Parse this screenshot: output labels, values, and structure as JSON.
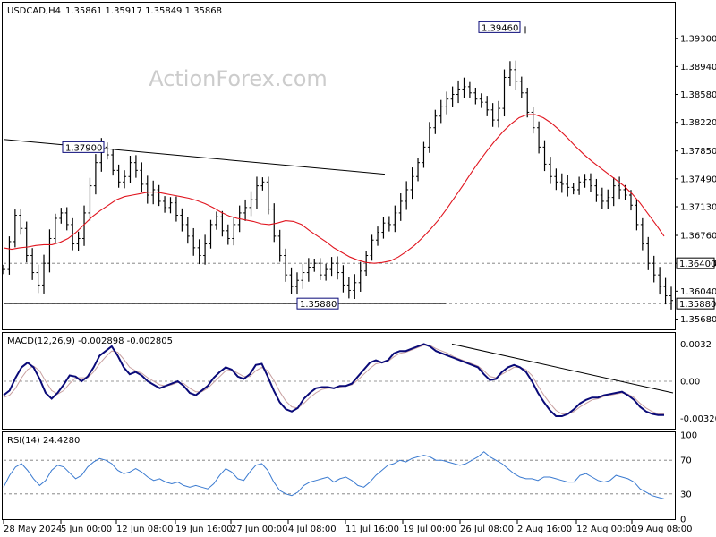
{
  "header": {
    "symbol_timeframe": "USDCAD,H4",
    "ohlc": "1.35861 1.35917 1.35849 1.35868"
  },
  "watermark": "ActionForex.com",
  "colors": {
    "price_bars": "#000000",
    "ema": "#e0141e",
    "macd_main": "#0a0a78",
    "macd_signal": "#c8a0a0",
    "rsi": "#3a7ad0",
    "trendline": "#000000",
    "label_border": "#0a0a78",
    "background": "#ffffff"
  },
  "chart_data": [
    {
      "type": "ohlc",
      "pane": "price",
      "symbol": "USDCAD",
      "timeframe": "H4",
      "y_ticks": [
        "1.39300",
        "1.38940",
        "1.38580",
        "1.38220",
        "1.37850",
        "1.37490",
        "1.37130",
        "1.36760",
        "1.36400",
        "1.36040",
        "1.35680"
      ],
      "ylim": [
        1.3557,
        1.3973
      ],
      "x_ticks": [
        "28 May 2024",
        "5 Jun 00:00",
        "12 Jun 08:00",
        "19 Jun 16:00",
        "27 Jun 00:00",
        "4 Jul 08:00",
        "11 Jul 16:00",
        "19 Jul 00:00",
        "26 Jul 08:00",
        "2 Aug 16:00",
        "12 Aug 00:00",
        "19 Aug 08:00"
      ],
      "key_levels": [
        {
          "label": "1.39460",
          "value": 1.3946
        },
        {
          "label": "1.37900",
          "value": 1.379
        },
        {
          "label": "1.35880",
          "value": 1.3588
        },
        {
          "label": "1.36400",
          "value": 1.364
        },
        {
          "label": "1.35880",
          "value": 1.3588
        }
      ],
      "horizontal_lines": [
        1.364,
        1.3588
      ],
      "trendline": {
        "from": {
          "x": "28 May 2024",
          "y": 1.38
        },
        "to": {
          "x": "18 Jul 2024",
          "y": 1.3755
        }
      },
      "support_line": {
        "from": {
          "x": "28 May 2024",
          "y": 1.3588
        },
        "to": {
          "x": "18 Jul 2024",
          "y": 1.3588
        }
      },
      "close_series": [
        1.3632,
        1.3668,
        1.3702,
        1.3685,
        1.365,
        1.3628,
        1.3612,
        1.364,
        1.3672,
        1.3698,
        1.3705,
        1.369,
        1.3665,
        1.3672,
        1.3705,
        1.374,
        1.377,
        1.379,
        1.378,
        1.376,
        1.3745,
        1.3752,
        1.377,
        1.376,
        1.3742,
        1.3728,
        1.3735,
        1.372,
        1.3712,
        1.3718,
        1.3702,
        1.369,
        1.3675,
        1.366,
        1.365,
        1.3665,
        1.369,
        1.37,
        1.3682,
        1.3672,
        1.369,
        1.3705,
        1.3712,
        1.3722,
        1.374,
        1.3745,
        1.371,
        1.3675,
        1.365,
        1.3625,
        1.361,
        1.3618,
        1.3628,
        1.3635,
        1.364,
        1.3625,
        1.3632,
        1.364,
        1.3628,
        1.3612,
        1.3605,
        1.3615,
        1.363,
        1.365,
        1.367,
        1.368,
        1.3692,
        1.369,
        1.3705,
        1.372,
        1.3735,
        1.3752,
        1.377,
        1.379,
        1.3815,
        1.383,
        1.3842,
        1.3852,
        1.3858,
        1.3865,
        1.3868,
        1.386,
        1.3852,
        1.3848,
        1.3838,
        1.3825,
        1.384,
        1.388,
        1.389,
        1.3875,
        1.386,
        1.3835,
        1.3815,
        1.379,
        1.3768,
        1.3752,
        1.3745,
        1.3742,
        1.3738,
        1.3735,
        1.3745,
        1.3748,
        1.374,
        1.3728,
        1.372,
        1.3725,
        1.374,
        1.3735,
        1.3728,
        1.3715,
        1.369,
        1.3665,
        1.364,
        1.3625,
        1.361,
        1.3598,
        1.3592
      ],
      "ema_series": [
        1.366,
        1.3658,
        1.366,
        1.3661,
        1.3663,
        1.3664,
        1.3664,
        1.3667,
        1.3672,
        1.368,
        1.369,
        1.37,
        1.3708,
        1.3715,
        1.3722,
        1.3726,
        1.3728,
        1.373,
        1.3732,
        1.3732,
        1.373,
        1.3728,
        1.3726,
        1.3724,
        1.3721,
        1.3717,
        1.3712,
        1.3706,
        1.3701,
        1.3698,
        1.3696,
        1.3694,
        1.3691,
        1.369,
        1.3692,
        1.3695,
        1.3694,
        1.369,
        1.3682,
        1.3675,
        1.3668,
        1.366,
        1.3654,
        1.3648,
        1.3644,
        1.3641,
        1.364,
        1.3641,
        1.3643,
        1.3648,
        1.3655,
        1.3663,
        1.3673,
        1.3684,
        1.3696,
        1.371,
        1.3725,
        1.374,
        1.3756,
        1.3771,
        1.3785,
        1.3798,
        1.381,
        1.382,
        1.3828,
        1.3832,
        1.3832,
        1.3828,
        1.3821,
        1.3812,
        1.3802,
        1.3791,
        1.3781,
        1.3772,
        1.3764,
        1.3756,
        1.3748,
        1.374,
        1.373,
        1.3718,
        1.3704,
        1.369,
        1.3675
      ]
    },
    {
      "type": "line",
      "pane": "macd",
      "label": "MACD(12,26,9) -0.002898 -0.002805",
      "y_ticks": [
        "0.0032",
        "0.00",
        "-0.003204"
      ],
      "ylim": [
        -0.004,
        0.004
      ],
      "series": [
        {
          "values": [
            -0.0012,
            -0.0008,
            0.0003,
            0.0012,
            0.0016,
            0.0012,
            0.0002,
            -0.001,
            -0.0015,
            -0.001,
            -0.0003,
            0.0005,
            0.0004,
            0.0,
            0.0004,
            0.0012,
            0.0022,
            0.0026,
            0.003,
            0.0022,
            0.0012,
            0.0006,
            0.0008,
            0.0005,
            0.0,
            -0.0003,
            -0.0006,
            -0.0004,
            -0.0002,
            0.0,
            -0.0004,
            -0.001,
            -0.0012,
            -0.0008,
            -0.0004,
            0.0003,
            0.0008,
            0.0012,
            0.001,
            0.0004,
            0.0002,
            0.0006,
            0.0014,
            0.0015,
            0.0004,
            -0.0008,
            -0.0018,
            -0.0024,
            -0.0026,
            -0.0023,
            -0.0015,
            -0.001,
            -0.0006,
            -0.0005,
            -0.0005,
            -0.0006,
            -0.0004,
            -0.0004,
            -0.0002,
            0.0004,
            0.001,
            0.0016,
            0.0018,
            0.0016,
            0.0018,
            0.0024,
            0.0026,
            0.0026,
            0.0028,
            0.003,
            0.0032,
            0.003,
            0.0026,
            0.0024,
            0.0022,
            0.002,
            0.0018,
            0.0016,
            0.0014,
            0.0012,
            0.0006,
            0.0001,
            0.0002,
            0.0008,
            0.0012,
            0.0014,
            0.0012,
            0.0008,
            0.0,
            -0.001,
            -0.0018,
            -0.0025,
            -0.003,
            -0.003,
            -0.0028,
            -0.0024,
            -0.0019,
            -0.0016,
            -0.0014,
            -0.0014,
            -0.0012,
            -0.0011,
            -0.001,
            -0.0009,
            -0.0012,
            -0.0016,
            -0.0022,
            -0.0026,
            -0.0028,
            -0.0029,
            -0.0029
          ]
        },
        {
          "values": [
            -0.0014,
            -0.0012,
            -0.0006,
            0.0003,
            0.001,
            0.0013,
            0.0009,
            0.0,
            -0.0008,
            -0.0011,
            -0.0008,
            -0.0002,
            0.0003,
            0.0003,
            0.0003,
            0.0008,
            0.0015,
            0.0021,
            0.0026,
            0.0025,
            0.0019,
            0.0012,
            0.0009,
            0.0007,
            0.0003,
            0.0,
            -0.0003,
            -0.0004,
            -0.0003,
            -0.0001,
            -0.0002,
            -0.0006,
            -0.0009,
            -0.0009,
            -0.0006,
            -0.0001,
            0.0004,
            0.0009,
            0.001,
            0.0007,
            0.0004,
            0.0004,
            0.0009,
            0.0012,
            0.0009,
            0.0001,
            -0.0009,
            -0.0017,
            -0.0022,
            -0.0023,
            -0.0019,
            -0.0014,
            -0.001,
            -0.0007,
            -0.0006,
            -0.0006,
            -0.0005,
            -0.0004,
            -0.0003,
            0.0001,
            0.0006,
            0.0011,
            0.0015,
            0.0016,
            0.0017,
            0.0021,
            0.0024,
            0.0025,
            0.0027,
            0.0029,
            0.0031,
            0.0031,
            0.0028,
            0.0026,
            0.0024,
            0.0021,
            0.0019,
            0.0017,
            0.0015,
            0.0013,
            0.0009,
            0.0004,
            0.0003,
            0.0006,
            0.0009,
            0.0012,
            0.0012,
            0.001,
            0.0005,
            -0.0004,
            -0.0012,
            -0.0019,
            -0.0025,
            -0.0028,
            -0.0028,
            -0.0026,
            -0.0022,
            -0.0019,
            -0.0016,
            -0.0015,
            -0.0013,
            -0.0012,
            -0.0011,
            -0.001,
            -0.0011,
            -0.0014,
            -0.0019,
            -0.0023,
            -0.0026,
            -0.0028,
            -0.0028
          ]
        }
      ],
      "trendline": {
        "from": {
          "x": "22 Jul 2024",
          "y": 0.0032
        },
        "to": {
          "x": "20 Aug 2024",
          "y": -0.001
        }
      }
    },
    {
      "type": "line",
      "pane": "rsi",
      "label": "RSI(14) 24.4280",
      "y_ticks": [
        "100",
        "70",
        "30",
        "0"
      ],
      "ylim": [
        0,
        100
      ],
      "levels": [
        70,
        30
      ],
      "series": [
        {
          "values": [
            38,
            52,
            62,
            66,
            58,
            48,
            40,
            46,
            58,
            64,
            62,
            55,
            48,
            52,
            62,
            68,
            72,
            70,
            66,
            58,
            54,
            56,
            60,
            56,
            50,
            46,
            48,
            44,
            42,
            44,
            40,
            38,
            40,
            38,
            36,
            42,
            52,
            60,
            56,
            48,
            46,
            56,
            64,
            66,
            58,
            44,
            34,
            30,
            28,
            32,
            40,
            44,
            46,
            48,
            50,
            44,
            48,
            50,
            46,
            40,
            38,
            44,
            52,
            58,
            64,
            66,
            70,
            68,
            72,
            74,
            76,
            74,
            70,
            70,
            68,
            66,
            64,
            66,
            70,
            74,
            80,
            74,
            70,
            66,
            60,
            54,
            50,
            48,
            48,
            46,
            50,
            50,
            48,
            46,
            44,
            44,
            52,
            54,
            50,
            46,
            44,
            46,
            52,
            50,
            48,
            44,
            36,
            32,
            28,
            26,
            24
          ]
        }
      ]
    }
  ]
}
